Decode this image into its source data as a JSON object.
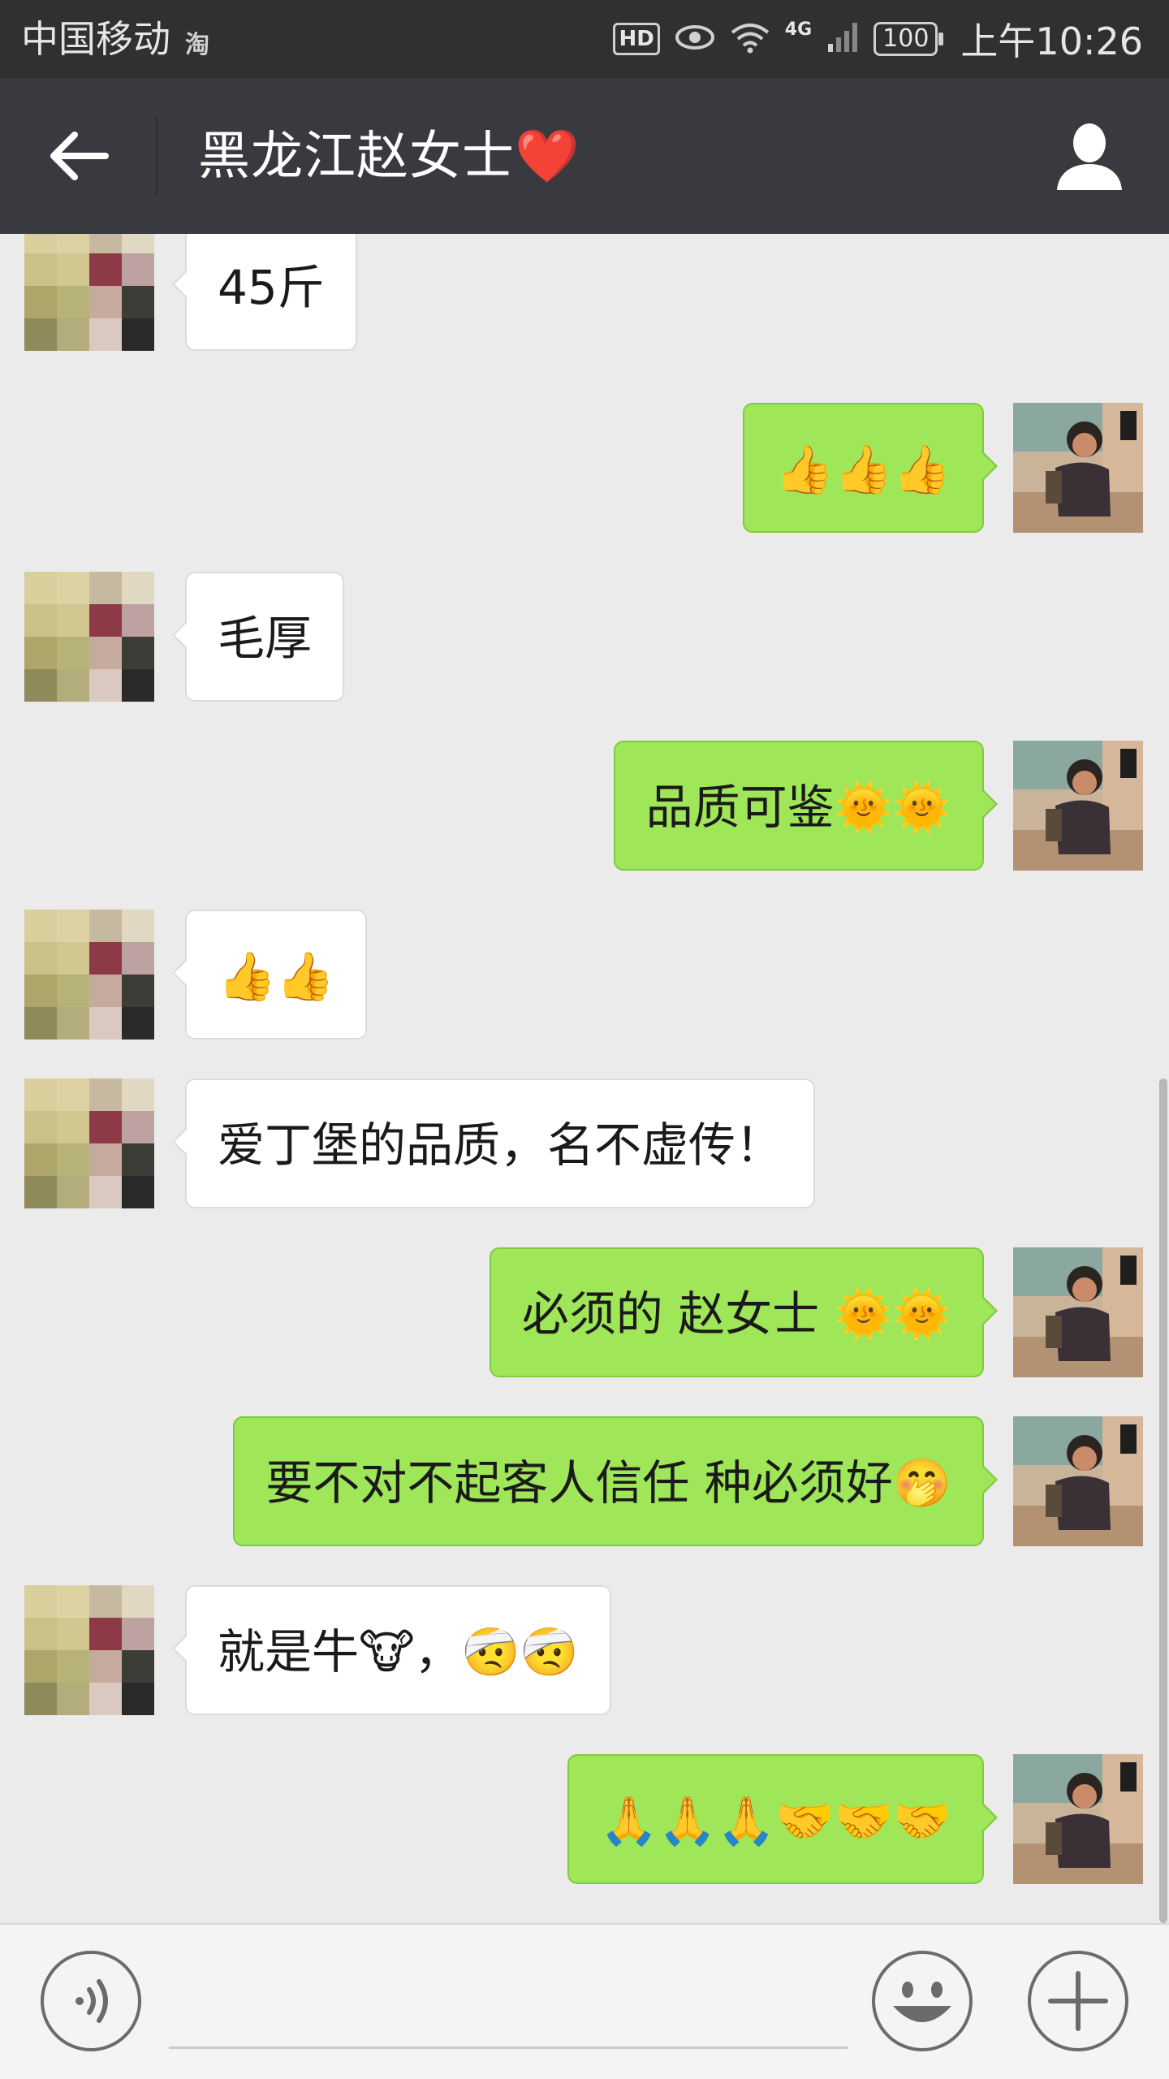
{
  "status_bar": {
    "carrier": "中国移动",
    "carrier_icon_text": "淘",
    "hd_label": "HD",
    "network": "4G",
    "battery": "100",
    "time": "上午10:26"
  },
  "header": {
    "title": "黑龙江赵女士❤️"
  },
  "messages": [
    {
      "from": "contact",
      "text": "45斤"
    },
    {
      "from": "me",
      "text": "👍👍👍"
    },
    {
      "from": "contact",
      "text": "毛厚"
    },
    {
      "from": "me",
      "text": "品质可鉴🌞🌞"
    },
    {
      "from": "contact",
      "text": "👍👍"
    },
    {
      "from": "contact",
      "text": "爱丁堡的品质，名不虚传！"
    },
    {
      "from": "me",
      "text": "必须的 赵女士 🌞🌞"
    },
    {
      "from": "me",
      "text": "要不对不起客人信任 种必须好🤭"
    },
    {
      "from": "contact",
      "text": "就是牛🐮，🤕🤕"
    },
    {
      "from": "me",
      "text": "🙏🙏🙏🤝🤝🤝"
    }
  ],
  "input": {
    "placeholder": ""
  },
  "icons": {
    "back": "back-arrow-icon",
    "profile": "person-icon",
    "voice": "voice-icon",
    "emoji": "emoji-icon",
    "plus": "plus-icon"
  },
  "colors": {
    "title_bar": "#393a3f",
    "status_bar": "#303030",
    "chat_bg": "#ebebeb",
    "outgoing_bubble": "#9fe658",
    "incoming_bubble": "#ffffff"
  }
}
